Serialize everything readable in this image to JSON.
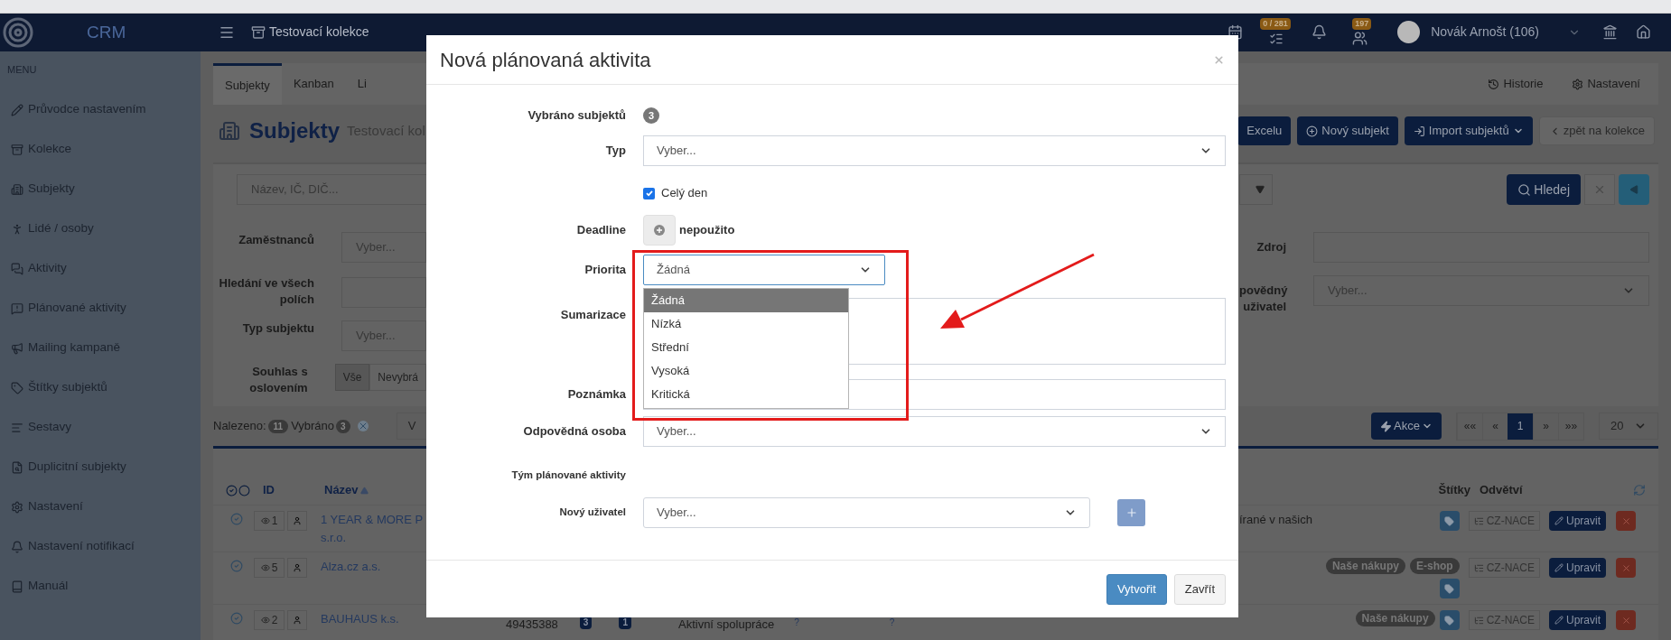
{
  "topbar": {
    "brand": "CRM",
    "collection": "Testovací kolekce",
    "tasks_badge": "0 / 281",
    "alerts_badge": "197",
    "user": "Novák Arnošt (106)"
  },
  "sidebar": {
    "heading": "MENU",
    "items": [
      {
        "label": "Průvodce nastavením"
      },
      {
        "label": "Kolekce"
      },
      {
        "label": "Subjekty"
      },
      {
        "label": "Lidé / osoby"
      },
      {
        "label": "Aktivity"
      },
      {
        "label": "Plánované aktivity"
      },
      {
        "label": "Mailing kampaně"
      },
      {
        "label": "Štítky subjektů"
      },
      {
        "label": "Sestavy"
      },
      {
        "label": "Duplicitní subjekty"
      },
      {
        "label": "Nastavení"
      },
      {
        "label": "Nastavení notifikací"
      },
      {
        "label": "Manuál"
      }
    ]
  },
  "tabs": [
    {
      "label": "Subjekty",
      "selected": true
    },
    {
      "label": "Kanban",
      "selected": false
    },
    {
      "label": "Li",
      "selected": false
    }
  ],
  "tab_links": [
    "Historie",
    "Nastavení"
  ],
  "header": {
    "title": "Subjekty",
    "subtitle": "Testovací kol",
    "buttons": [
      {
        "label": "Excelu",
        "kind": "plain"
      },
      {
        "label": "Nový subjekt",
        "kind": "add"
      },
      {
        "label": "Import subjektů",
        "kind": "import"
      },
      {
        "label": "zpět na kolekce",
        "kind": "back"
      }
    ]
  },
  "filters": {
    "search_placeholder": "Název, IČ, DIČ...",
    "search_button": "Hledej",
    "left": [
      {
        "kind": "select",
        "label": "Zaměstnanců",
        "placeholder": "Vyber..."
      },
      {
        "kind": "input",
        "label": "Hledání ve všech polích"
      },
      {
        "kind": "select",
        "label": "Typ subjektu",
        "placeholder": "Vyber..."
      },
      {
        "kind": "segmented",
        "label": "Souhlas s oslovením",
        "options": [
          {
            "label": "Vše",
            "selected": true
          },
          {
            "label": "Nevybrá",
            "selected": false
          }
        ]
      }
    ],
    "right": [
      {
        "kind": "input",
        "label": "Zdroj"
      },
      {
        "kind": "select",
        "label": "povědný uživatel",
        "placeholder": "Vyber..."
      }
    ]
  },
  "results": {
    "found_label": "Nalezeno:",
    "found": "11",
    "selected_label": "Vybráno",
    "selected": "3",
    "view": "V",
    "actions": "Akce",
    "pages": [
      {
        "label": "««",
        "selected": false
      },
      {
        "label": "«",
        "selected": false
      },
      {
        "label": "1",
        "selected": true
      },
      {
        "label": "»",
        "selected": false
      },
      {
        "label": "»»",
        "selected": false
      }
    ],
    "page_size": "20"
  },
  "table": {
    "columns": {
      "id": "ID",
      "name": "Název",
      "tags": "Štítky",
      "sector": "Odvětví"
    },
    "rows": [
      {
        "id": "1",
        "name": [
          "1 YEAR & MORE P",
          "s.r.o."
        ],
        "description": "írané v našich",
        "tags": [],
        "sector": "CZ-NACE",
        "edit": "Upravit"
      },
      {
        "id": "5",
        "name": [
          "Alza.cz a.s."
        ],
        "tags": [
          "Naše nákupy",
          "E-shop"
        ],
        "sector": "CZ-NACE",
        "edit": "Upravit"
      },
      {
        "id": "2",
        "name": [
          "BAUHAUS k.s."
        ],
        "ico": "49435388",
        "counts": [
          "3",
          "1"
        ],
        "status": "Aktivní spolupráce",
        "flags": [
          "?",
          "?"
        ],
        "tags": [
          "Naše nákupy"
        ],
        "sector": "CZ-NACE",
        "edit": "Upravit"
      }
    ]
  },
  "modal": {
    "title": "Nová plánovaná aktivita",
    "fields": [
      {
        "kind": "count",
        "label": "Vybráno subjektů",
        "value": "3"
      },
      {
        "kind": "select",
        "label": "Typ",
        "value": "Vyber..."
      },
      {
        "kind": "checkbox",
        "text": "Celý den",
        "checked": true
      },
      {
        "kind": "optional",
        "label": "Deadline",
        "text": "nepoužito"
      },
      {
        "kind": "dropdown",
        "label": "Priorita",
        "value": "Žádná",
        "expanded": true,
        "options": [
          {
            "label": "Žádná",
            "selected": true
          },
          {
            "label": "Nízká",
            "selected": false
          },
          {
            "label": "Střední",
            "selected": false
          },
          {
            "label": "Vysoká",
            "selected": false
          },
          {
            "label": "Kritická",
            "selected": false
          }
        ]
      },
      {
        "kind": "textarea",
        "label": "Sumarizace"
      },
      {
        "kind": "input",
        "label": "Poznámka"
      },
      {
        "kind": "select",
        "label": "Odpovědná osoba",
        "value": "Vyber..."
      },
      {
        "kind": "section",
        "label": "Tým plánované aktivity"
      },
      {
        "kind": "select_add",
        "label": "Nový uživatel",
        "value": "Vyber..."
      }
    ],
    "buttons": [
      {
        "label": "Vytvořit",
        "kind": "primary"
      },
      {
        "label": "Zavřít",
        "kind": "default"
      }
    ]
  }
}
